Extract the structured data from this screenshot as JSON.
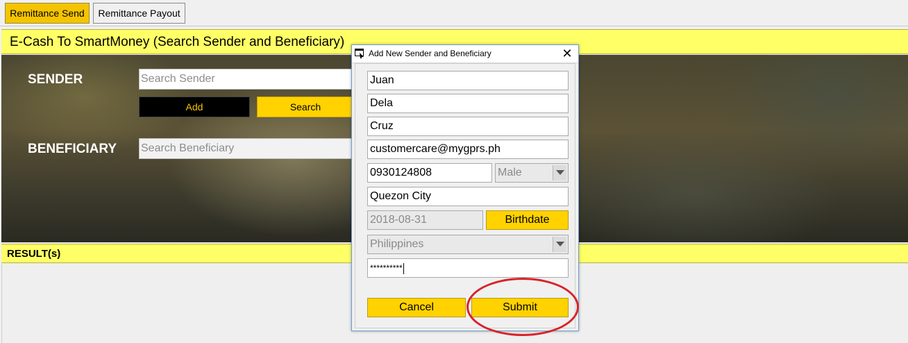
{
  "tabs": {
    "send": "Remittance Send",
    "payout": "Remittance Payout"
  },
  "title": "E-Cash To SmartMoney (Search Sender and Beneficiary)",
  "sender": {
    "label": "SENDER",
    "search_placeholder": "Search Sender",
    "add_label": "Add",
    "search_label": "Search"
  },
  "beneficiary": {
    "label": "BENEFICIARY",
    "search_placeholder": "Search Beneficiary"
  },
  "results": {
    "label": "RESULT(s)"
  },
  "dialog": {
    "title": "Add New Sender and Beneficiary",
    "close": "✕",
    "first_name": "Juan",
    "middle_name": "Dela",
    "last_name": "Cruz",
    "email": "customercare@mygprs.ph",
    "mobile": "0930124808",
    "gender": "Male",
    "city": "Quezon City",
    "birthdate": "2018-08-31",
    "birthdate_button": "Birthdate",
    "country": "Philippines",
    "password": "**********",
    "cancel_label": "Cancel",
    "submit_label": "Submit"
  },
  "colors": {
    "accent_yellow": "#ffd200",
    "title_yellow": "#ffff66",
    "highlight_red": "#d8232a"
  }
}
